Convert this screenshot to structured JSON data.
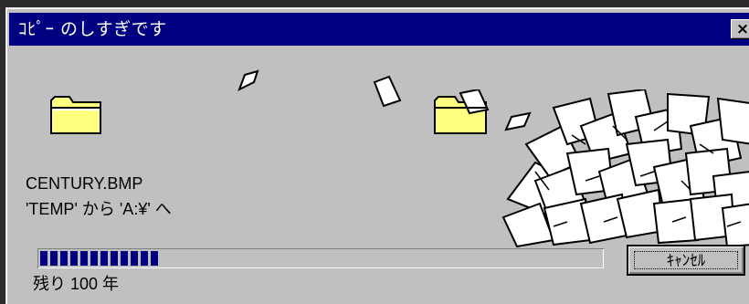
{
  "window": {
    "title": "ｺﾋﾟｰ のしすぎです",
    "close_label": "×"
  },
  "copy": {
    "filename": "CENTURY.BMP",
    "route": "'TEMP' から 'A:¥' へ",
    "remaining": "残り 100 年",
    "progress": 0.22
  },
  "buttons": {
    "cancel": "ｷｬﾝｾﾙ"
  },
  "icons": {
    "source": "folder-icon",
    "destination": "folder-icon",
    "flying": "paper-icon",
    "pile": "paper-pile-icon"
  },
  "colors": {
    "titlebar": "#000080",
    "face": "#c0c0c0",
    "folder": "#ffff80",
    "progress": "#000080"
  }
}
